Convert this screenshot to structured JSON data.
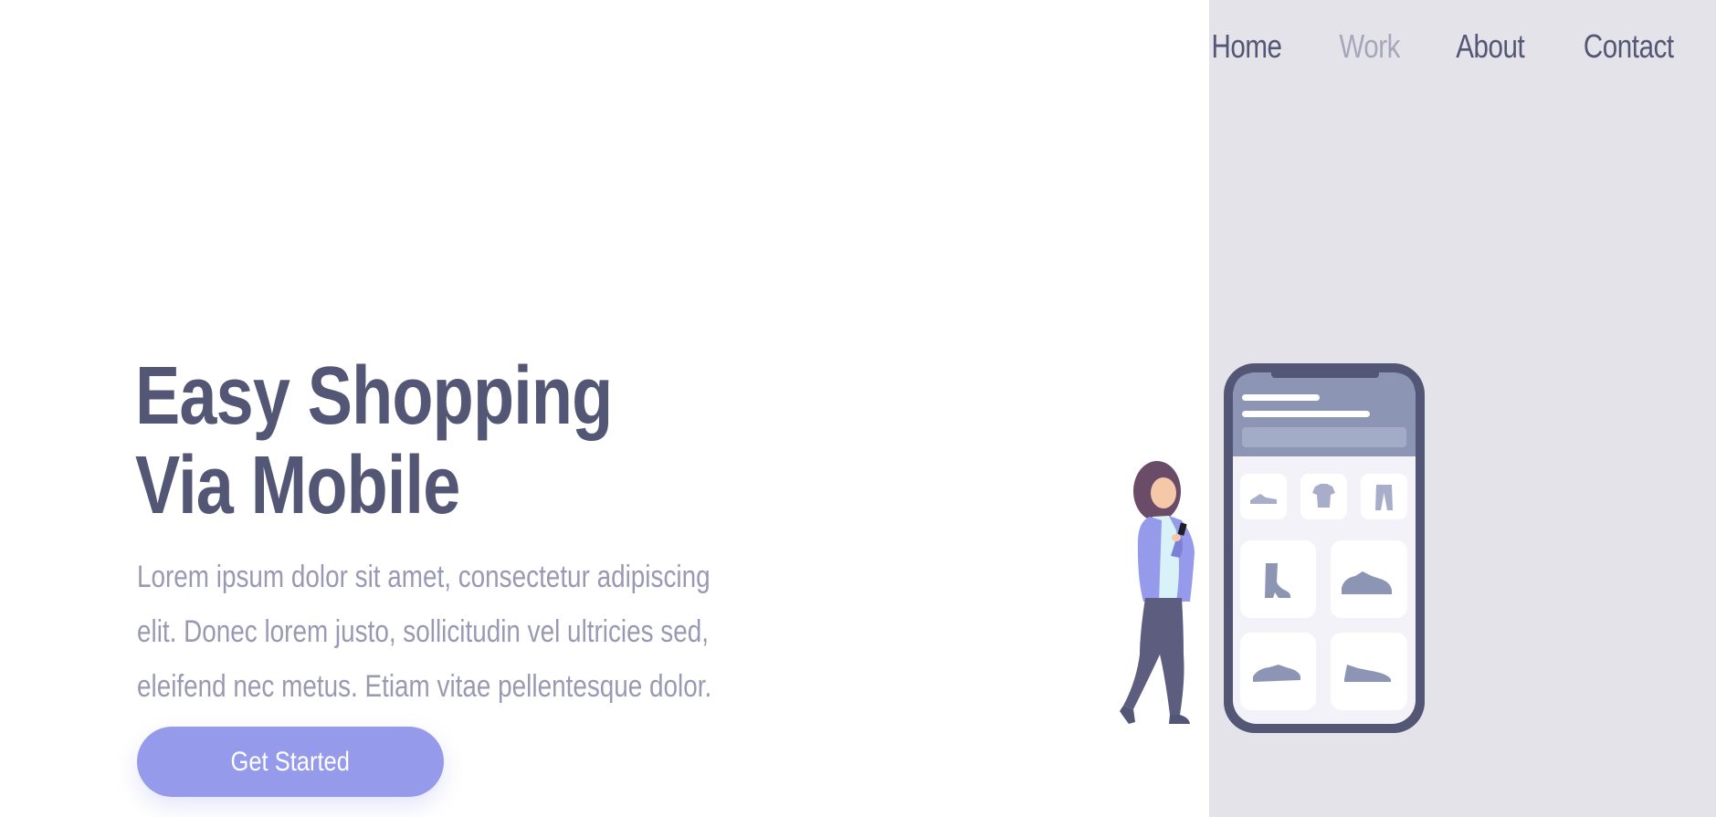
{
  "nav": {
    "items": [
      {
        "label": "Home",
        "active": false
      },
      {
        "label": "Work",
        "active": true
      },
      {
        "label": "About",
        "active": false
      },
      {
        "label": "Contact",
        "active": false
      }
    ]
  },
  "hero": {
    "title_line1": "Easy Shopping",
    "title_line2": "Via Mobile",
    "description": "Lorem ipsum dolor sit amet, consectetur adipiscing elit. Donec lorem justo, sollicitudin vel ultricies sed, eleifend nec metus. Etiam vitae pellentesque dolor.",
    "cta_label": "Get Started"
  },
  "colors": {
    "primary_text": "#545675",
    "muted_text": "#9a99b4",
    "accent": "#959aea",
    "side_panel": "#e4e3ea",
    "nav_active": "#a7a7bb"
  }
}
